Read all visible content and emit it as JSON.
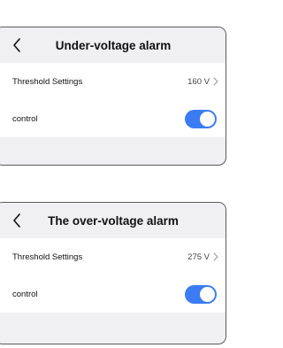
{
  "under_voltage": {
    "title": "Under-voltage alarm",
    "back_icon": "back-arrow-icon",
    "threshold_label": "Threshold Settings",
    "threshold_value": "160 V",
    "control_label": "control",
    "control_enabled": true
  },
  "over_voltage": {
    "title": "The over-voltage alarm",
    "back_icon": "back-arrow-icon",
    "threshold_label": "Threshold Settings",
    "threshold_value": "275 V",
    "control_label": "control",
    "control_enabled": true
  },
  "colors": {
    "toggle_on": "#3b7cf4",
    "panel_bg": "#f0f0f2",
    "row_bg": "#ffffff"
  }
}
